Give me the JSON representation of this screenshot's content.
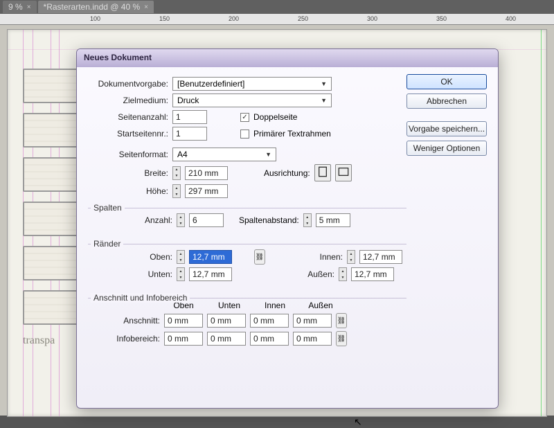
{
  "tabs": [
    {
      "label": "9 %",
      "active": false
    },
    {
      "label": "*Rasterarten.indd @ 40 %",
      "active": true
    }
  ],
  "ruler_marks": [
    "100",
    "150",
    "200",
    "250",
    "300",
    "350",
    "400"
  ],
  "sketch_caption": "transpa",
  "guide_positions_v": [
    22,
    36,
    62,
    74,
    100,
    112,
    140,
    154,
    780
  ],
  "dialog": {
    "title": "Neues Dokument",
    "buttons": {
      "ok": "OK",
      "cancel": "Abbrechen",
      "save_preset": "Vorgabe speichern...",
      "fewer_options": "Weniger Optionen"
    },
    "preset": {
      "label": "Dokumentvorgabe:",
      "value": "[Benutzerdefiniert]"
    },
    "intent": {
      "label": "Zielmedium:",
      "value": "Druck"
    },
    "pages": {
      "label": "Seitenanzahl:",
      "value": "1"
    },
    "start_page": {
      "label": "Startseitennr.:",
      "value": "1"
    },
    "facing": {
      "label": "Doppelseite",
      "checked": true
    },
    "primary_frame": {
      "label": "Primärer Textrahmen",
      "checked": false
    },
    "page_size": {
      "label": "Seitenformat:",
      "value": "A4"
    },
    "width": {
      "label": "Breite:",
      "value": "210 mm"
    },
    "height": {
      "label": "Höhe:",
      "value": "297 mm"
    },
    "orientation_label": "Ausrichtung:",
    "columns": {
      "title": "Spalten",
      "count": {
        "label": "Anzahl:",
        "value": "6"
      },
      "gutter": {
        "label": "Spaltenabstand:",
        "value": "5 mm"
      }
    },
    "margins": {
      "title": "Ränder",
      "top": {
        "label": "Oben:",
        "value": "12,7 mm"
      },
      "bottom": {
        "label": "Unten:",
        "value": "12,7 mm"
      },
      "inside": {
        "label": "Innen:",
        "value": "12,7 mm"
      },
      "outside": {
        "label": "Außen:",
        "value": "12,7 mm"
      }
    },
    "bleed_slug": {
      "title": "Anschnitt und Infobereich",
      "headers": [
        "Oben",
        "Unten",
        "Innen",
        "Außen"
      ],
      "bleed": {
        "label": "Anschnitt:",
        "values": [
          "0 mm",
          "0 mm",
          "0 mm",
          "0 mm"
        ]
      },
      "slug": {
        "label": "Infobereich:",
        "values": [
          "0 mm",
          "0 mm",
          "0 mm",
          "0 mm"
        ]
      }
    }
  }
}
